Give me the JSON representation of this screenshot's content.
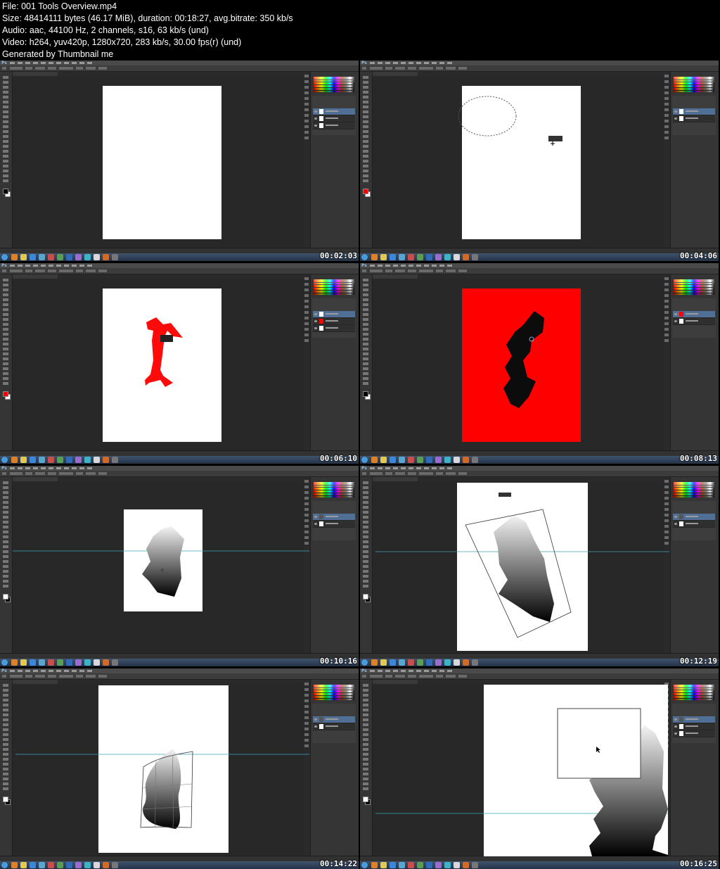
{
  "header": {
    "line1": "File: 001 Tools Overview.mp4",
    "line2": "Size: 48414111 bytes (46.17 MiB), duration: 00:18:27, avg.bitrate: 350 kb/s",
    "line3": "Audio: aac, 44100 Hz, 2 channels, s16, 63 kb/s (und)",
    "line4": "Video: h264, yuv420p, 1280x720, 283 kb/s, 30.00 fps(r) (und)",
    "line5": "Generated by Thumbnail me"
  },
  "app": {
    "logo": "Ps"
  },
  "frames": [
    {
      "timestamp": "00:02:03",
      "scene": "blank-canvas"
    },
    {
      "timestamp": "00:04:06",
      "scene": "elliptical-marquee"
    },
    {
      "timestamp": "00:06:10",
      "scene": "red-shape"
    },
    {
      "timestamp": "00:08:13",
      "scene": "black-shape-red-bg"
    },
    {
      "timestamp": "00:10:16",
      "scene": "gradient-shape"
    },
    {
      "timestamp": "00:12:19",
      "scene": "free-transform"
    },
    {
      "timestamp": "00:14:22",
      "scene": "warp"
    },
    {
      "timestamp": "00:16:25",
      "scene": "zoomed-selection"
    }
  ],
  "colors": {
    "ui_dark": "#2a2a2a",
    "panel": "#353535",
    "selected_layer": "#4f6f97",
    "red": "#ff0000",
    "guide": "#3aa7b8"
  },
  "icons": [
    "ps-logo-icon",
    "start-icon",
    "eye-icon",
    "cursor-icon"
  ]
}
